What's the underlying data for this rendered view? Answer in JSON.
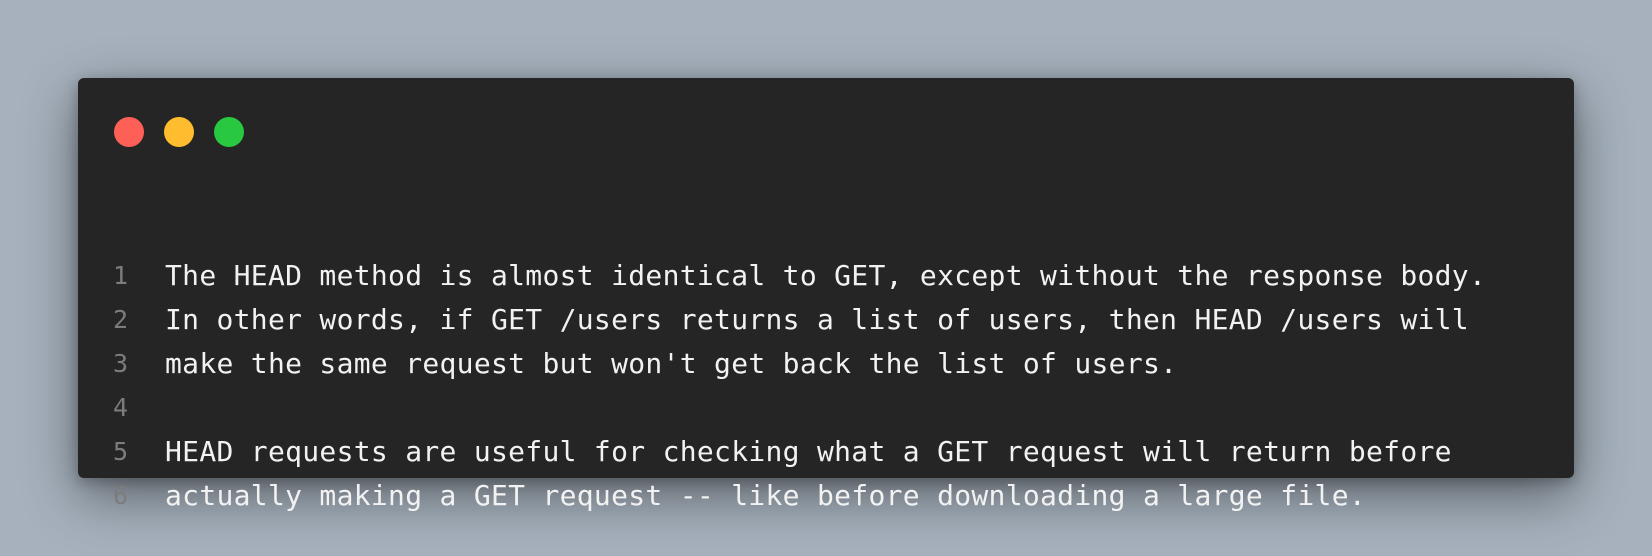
{
  "window": {
    "controls": [
      {
        "name": "close",
        "color": "#fe5f57"
      },
      {
        "name": "minimize",
        "color": "#febc2e"
      },
      {
        "name": "maximize",
        "color": "#28c840"
      }
    ]
  },
  "code": {
    "lines": [
      {
        "number": "1",
        "text": "The HEAD method is almost identical to GET, except without the response body."
      },
      {
        "number": "2",
        "text": "In other words, if GET /users returns a list of users, then HEAD /users will"
      },
      {
        "number": "3",
        "text": "make the same request but won't get back the list of users."
      },
      {
        "number": "4",
        "text": ""
      },
      {
        "number": "5",
        "text": "HEAD requests are useful for checking what a GET request will return before"
      },
      {
        "number": "6",
        "text": "actually making a GET request -- like before downloading a large file."
      }
    ]
  }
}
